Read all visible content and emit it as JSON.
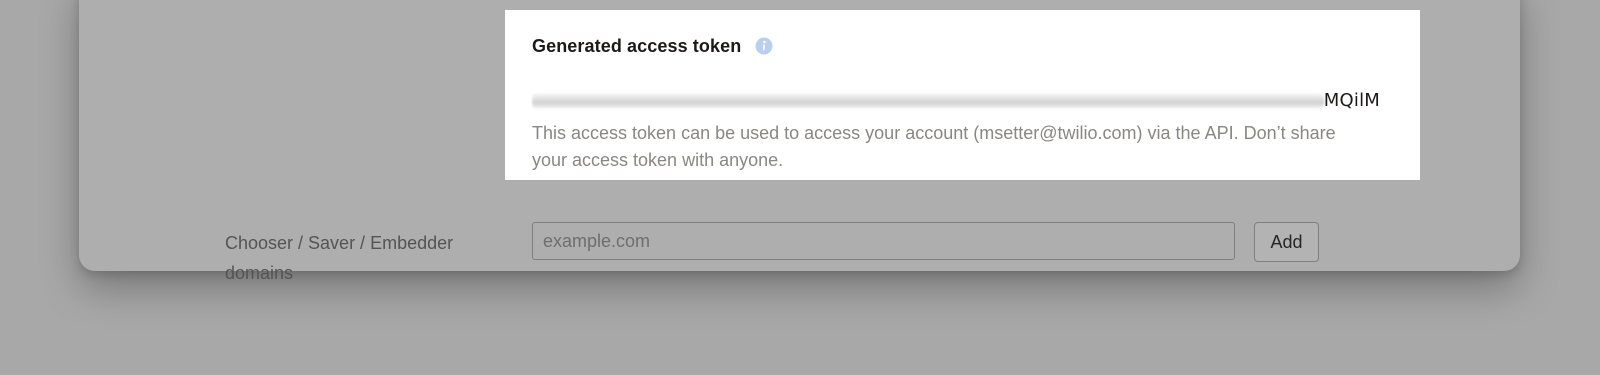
{
  "token_panel": {
    "title": "Generated access token",
    "info_icon": "info-icon",
    "token_visible_suffix": "MQilM",
    "description": "This access token can be used to access your account (msetter@twilio.com) via the API. Don’t share your access token with anyone."
  },
  "domains_form": {
    "label": "Chooser / Saver / Embedder domains",
    "input_placeholder": "example.com",
    "add_label": "Add"
  },
  "colors": {
    "overlay_dim": "#a8a8a8",
    "panel_bg": "#ffffff",
    "info_icon": "#b8cff0",
    "title_text": "#1e1919",
    "desc_text": "#8a8780"
  }
}
